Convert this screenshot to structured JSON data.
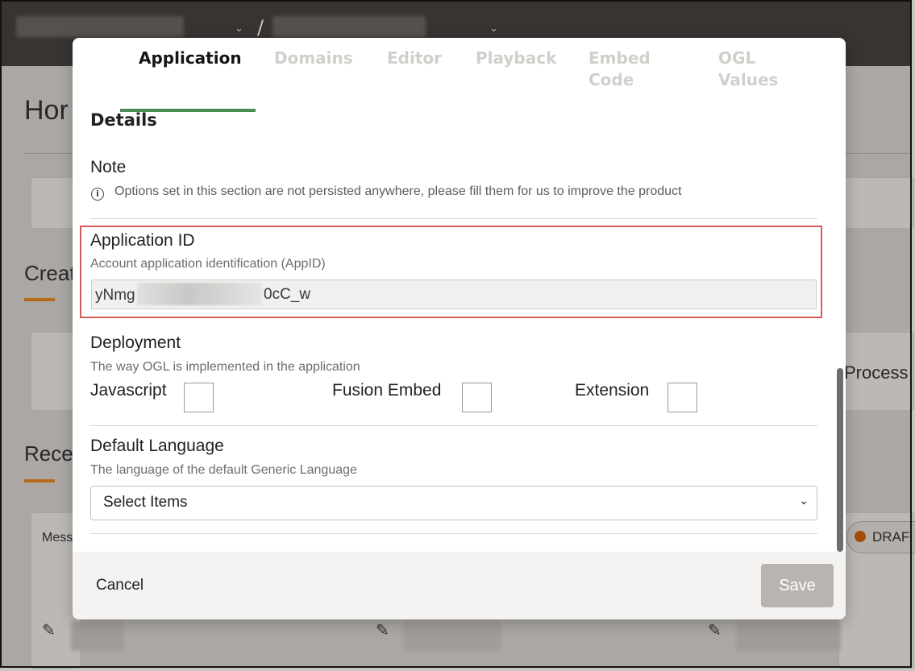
{
  "modal": {
    "tabs": [
      {
        "label": "Application"
      },
      {
        "label": "Domains"
      },
      {
        "label": "Editor"
      },
      {
        "label": "Playback"
      },
      {
        "label": "Embed Code"
      },
      {
        "label": "OGL Values"
      }
    ],
    "details_title": "Details",
    "note": {
      "label": "Note",
      "text": "Options set in this section are not persisted anywhere, please fill them for us to improve the product"
    },
    "application_id": {
      "label": "Application ID",
      "description": "Account application identification (AppID)",
      "value_prefix": "yNmg",
      "value_suffix": "0cC_w"
    },
    "deployment": {
      "label": "Deployment",
      "description": "The way OGL is implemented in the application",
      "options": [
        "Javascript",
        "Fusion Embed",
        "Extension"
      ]
    },
    "default_language": {
      "label": "Default Language",
      "description": "The language of the default Generic Language",
      "select_placeholder": "Select Items"
    },
    "footer": {
      "cancel_label": "Cancel",
      "save_label": "Save"
    }
  },
  "background": {
    "heading_partial": "Hor",
    "create_partial": "Creat",
    "recent_partial": "Rece",
    "process_partial": "Process",
    "message_partial": "Mess",
    "badge_partial": "DRAF"
  },
  "colors": {
    "tab_underline": "#4c8a58",
    "highlight_border": "#d35d5d",
    "save_disabled": "#b8b5b1"
  }
}
